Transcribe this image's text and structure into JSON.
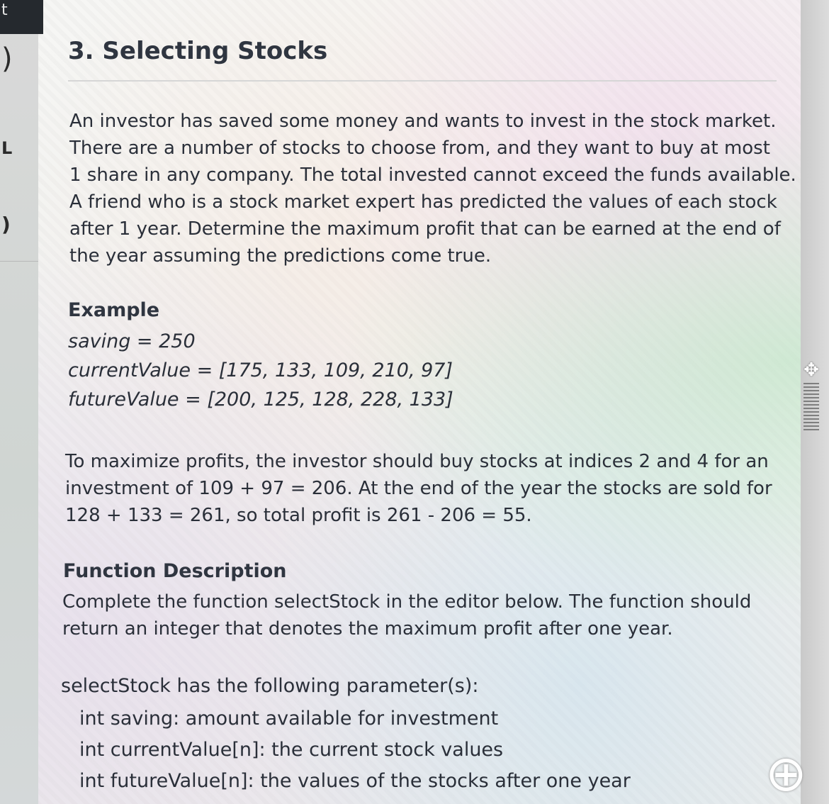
{
  "sidebar": {
    "top_text": "t",
    "marks": [
      "L"
    ]
  },
  "problem": {
    "title": "3. Selecting Stocks",
    "intro_lines": [
      "An investor has saved some money and wants to invest in the stock market.",
      "There are a number of stocks to choose from, and they want to buy at most",
      "1 share in any company. The total invested cannot exceed the funds available.",
      "A friend who is a stock market expert has predicted the values of each stock",
      "after 1 year. Determine the maximum profit that can be earned at the end of",
      "the year assuming the predictions come true."
    ]
  },
  "example": {
    "heading": "Example",
    "lines": [
      "saving = 250",
      "currentValue = [175, 133, 109, 210, 97]",
      "futureValue = [200, 125, 128, 228, 133]"
    ]
  },
  "explanation": {
    "lines": [
      "To maximize profits, the investor should buy stocks at indices 2 and 4 for an",
      "investment of 109 + 97 = 206. At the end of the year the stocks are sold for",
      "128 + 133 = 261, so total profit is 261 - 206 = 55."
    ]
  },
  "function_description": {
    "heading": "Function Description",
    "lines": [
      "Complete the function selectStock in the editor below. The function should",
      "return an integer that denotes the maximum profit after one year."
    ]
  },
  "parameters": {
    "intro": "selectStock has the following parameter(s):",
    "items": [
      "int saving: amount available for investment",
      "int currentValue[n]: the current stock values",
      "int futureValue[n]: the values of the stocks after one year"
    ]
  },
  "corner_glyph": "⊕"
}
